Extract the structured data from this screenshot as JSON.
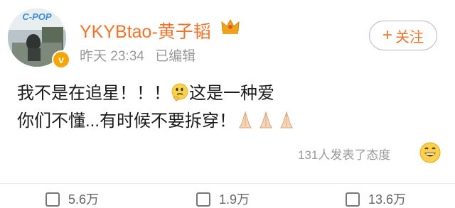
{
  "profile": {
    "username": "YKYBtao-黄子韬",
    "avatar_text": "C-POP",
    "verified_badge": "v",
    "time": "昨天 23:34",
    "edited": "已编辑"
  },
  "follow_button": {
    "plus": "+",
    "label": "关注"
  },
  "post": {
    "line1_a": "我不是在追星！！！",
    "line1_b": "这是一种爱",
    "line2": "你们不懂...有时候不要拆穿！"
  },
  "reactions": {
    "summary": "131人发表了态度"
  },
  "actions": {
    "repost_count": "5.6万",
    "comment_count": "1.9万",
    "like_count": "13.6万"
  },
  "colors": {
    "accent": "#f0732a",
    "muted": "#999999",
    "badge": "#f7a500"
  },
  "icons": [
    "crown-icon",
    "thinking-emoji",
    "praying-hands-emoji",
    "grinning-emoji",
    "repost-icon",
    "comment-icon",
    "like-icon"
  ]
}
